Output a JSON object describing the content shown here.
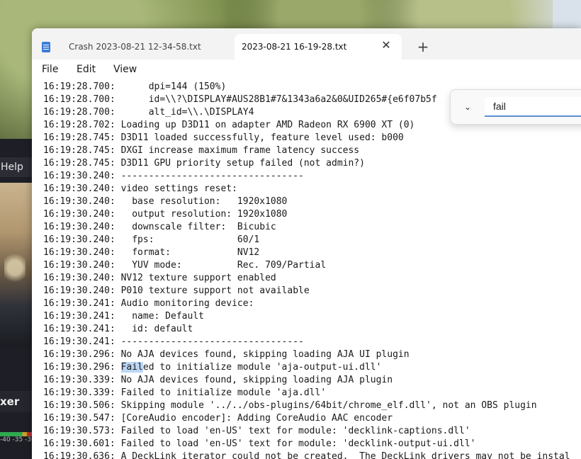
{
  "obs": {
    "menu_help": "Help",
    "mixer_label": "xer",
    "meter_scale": "-40 -35 -30"
  },
  "notepad": {
    "tabs": [
      {
        "label": "Crash 2023-08-21 12-34-58.txt",
        "active": false
      },
      {
        "label": "2023-08-21 16-19-28.txt",
        "active": true
      }
    ],
    "new_tab": "+",
    "close_glyph": "✕",
    "menu": [
      "File",
      "Edit",
      "View"
    ],
    "find": {
      "value": "fail",
      "chevron": "⌄"
    },
    "lines": [
      "16:19:28.700:      dpi=144 (150%)",
      "16:19:28.700:      id=\\\\?\\DISPLAY#AUS28B1#7&1343a6a2&0&UID265#{e6f07b5f",
      "16:19:28.700:      alt_id=\\\\.\\DISPLAY4",
      "16:19:28.702: Loading up D3D11 on adapter AMD Radeon RX 6900 XT (0)",
      "16:19:28.745: D3D11 loaded successfully, feature level used: b000",
      "16:19:28.745: DXGI increase maximum frame latency success",
      "16:19:28.745: D3D11 GPU priority setup failed (not admin?)",
      "16:19:30.240: ---------------------------------",
      "16:19:30.240: video settings reset:",
      "16:19:30.240:   base resolution:   1920x1080",
      "16:19:30.240:   output resolution: 1920x1080",
      "16:19:30.240:   downscale filter:  Bicubic",
      "16:19:30.240:   fps:               60/1",
      "16:19:30.240:   format:            NV12",
      "16:19:30.240:   YUV mode:          Rec. 709/Partial",
      "16:19:30.240: NV12 texture support enabled",
      "16:19:30.240: P010 texture support not available",
      "16:19:30.241: Audio monitoring device:",
      "16:19:30.241:   name: Default",
      "16:19:30.241:   id: default",
      "16:19:30.241: ---------------------------------",
      "16:19:30.296: No AJA devices found, skipping loading AJA UI plugin",
      "16:19:30.296: Failed to initialize module 'aja-output-ui.dll'",
      "16:19:30.339: No AJA devices found, skipping loading AJA plugin",
      "16:19:30.339: Failed to initialize module 'aja.dll'",
      "16:19:30.506: Skipping module '../../obs-plugins/64bit/chrome_elf.dll', not an OBS plugin",
      "16:19:30.547: [CoreAudio encoder]: Adding CoreAudio AAC encoder",
      "16:19:30.573: Failed to load 'en-US' text for module: 'decklink-captions.dll'",
      "16:19:30.601: Failed to load 'en-US' text for module: 'decklink-output-ui.dll'",
      "16:19:30.636: A DeckLink iterator could not be created.  The DeckLink drivers may not be instal"
    ],
    "highlight": {
      "line_index": 22,
      "prefix": "16:19:30.296: ",
      "match": "Fail",
      "rest": "ed to initialize module 'aja-output-ui.dll'"
    }
  },
  "colors": {
    "highlight": "#bcd7f5",
    "find_underline": "#5e8fd1",
    "doc_icon": "#3b7dd8"
  }
}
